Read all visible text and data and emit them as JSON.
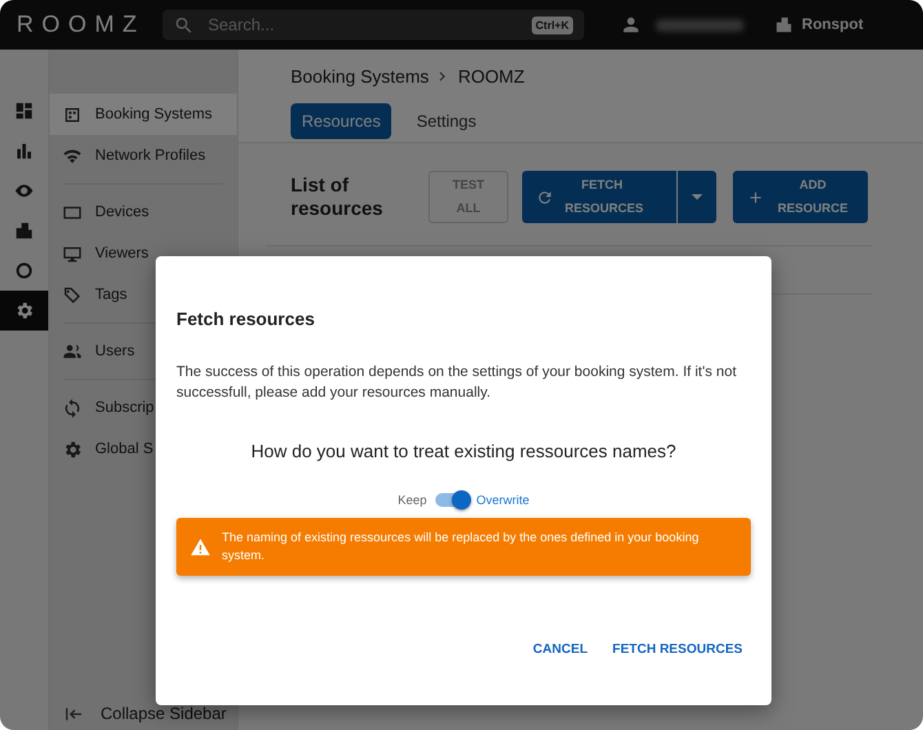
{
  "app_bar": {
    "logo": "ROOMZ",
    "search": {
      "placeholder": "Search...",
      "shortcut": "Ctrl+K"
    },
    "organization": "Ronspot"
  },
  "rail": {
    "items": [
      {
        "kind": "dashboard",
        "selected": false
      },
      {
        "kind": "chart",
        "selected": false
      },
      {
        "kind": "eye",
        "selected": false
      },
      {
        "kind": "building",
        "selected": false
      },
      {
        "kind": "ring",
        "selected": false
      },
      {
        "kind": "gear",
        "selected": true
      }
    ]
  },
  "sidebar": {
    "groups": [
      [
        {
          "label": "Booking Systems",
          "kind": "calendar",
          "selected": true
        },
        {
          "label": "Network Profiles",
          "kind": "wifi",
          "selected": false
        }
      ],
      [
        {
          "label": "Devices",
          "kind": "tablet",
          "selected": false
        },
        {
          "label": "Viewers",
          "kind": "monitor",
          "selected": false
        },
        {
          "label": "Tags",
          "kind": "tag",
          "selected": false
        }
      ],
      [
        {
          "label": "Users",
          "kind": "users",
          "selected": false
        }
      ],
      [
        {
          "label": "Subscrip",
          "kind": "sync",
          "selected": false
        },
        {
          "label": "Global S",
          "kind": "gear",
          "selected": false
        }
      ]
    ],
    "collapse": "Collapse Sidebar"
  },
  "breadcrumb": [
    "Booking Systems",
    "ROOMZ"
  ],
  "tabs": [
    {
      "label": "Resources",
      "selected": true
    },
    {
      "label": "Settings",
      "selected": false
    }
  ],
  "list_title": "List of resources",
  "actions": [
    {
      "label": "TEST ALL",
      "kind": "outlined",
      "disabled": true
    },
    {
      "label": "FETCH RESOURCES",
      "kind": "split",
      "disabled": false
    },
    {
      "label": "ADD RESOURCE",
      "kind": "add",
      "disabled": false
    }
  ],
  "dialog": {
    "title": "Fetch resources",
    "body": "The success of this operation depends on the settings of your booking system. If it's not successfull, please add your resources manually.",
    "question": "How do you want to treat existing ressources names?",
    "toggle": {
      "off_label": "Keep",
      "on_label": "Overwrite",
      "on": true
    },
    "alert": "The naming of existing ressources will be replaced by the ones defined in your booking system.",
    "buttons": [
      "CANCEL",
      "FETCH RESOURCES"
    ]
  }
}
